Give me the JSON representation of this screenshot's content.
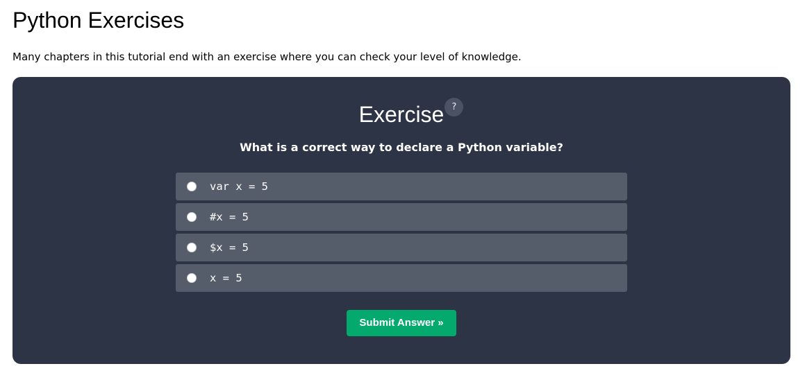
{
  "page": {
    "title": "Python Exercises",
    "intro": "Many chapters in this tutorial end with an exercise where you can check your level of knowledge."
  },
  "exercise": {
    "heading": "Exercise",
    "help_icon": "question-mark-icon",
    "help_glyph": "?",
    "question": "What is a correct way to declare a Python variable?",
    "options": [
      {
        "label": "var x = 5",
        "selected": false
      },
      {
        "label": "#x = 5",
        "selected": false
      },
      {
        "label": "$x = 5",
        "selected": false
      },
      {
        "label": "x = 5",
        "selected": false
      }
    ],
    "submit_label": "Submit Answer »"
  },
  "colors": {
    "panel_background": "#2d3446",
    "option_background": "#555d6b",
    "submit_button": "#04aa6d"
  }
}
